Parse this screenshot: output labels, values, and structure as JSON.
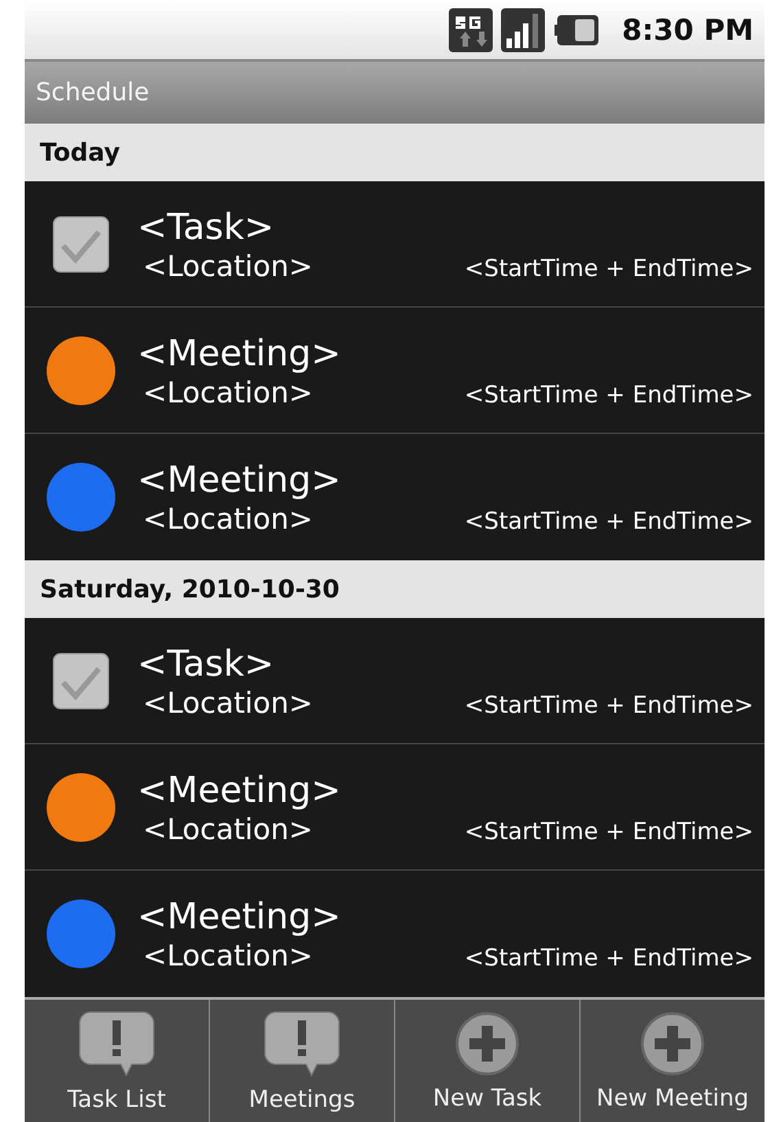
{
  "status_bar": {
    "time": "8:30 PM"
  },
  "title_bar": {
    "title": "Schedule"
  },
  "sections": [
    {
      "header": "Today",
      "items": [
        {
          "kind": "task",
          "title": "<Task>",
          "location": "<Location>",
          "time": "<StartTime + EndTime>",
          "checked": true
        },
        {
          "kind": "meeting",
          "title": "<Meeting>",
          "location": "<Location>",
          "time": "<StartTime + EndTime>",
          "color": "#f07a10"
        },
        {
          "kind": "meeting",
          "title": "<Meeting>",
          "location": "<Location>",
          "time": "<StartTime + EndTime>",
          "color": "#1e6cf0"
        }
      ]
    },
    {
      "header": "Saturday, 2010-10-30",
      "items": [
        {
          "kind": "task",
          "title": "<Task>",
          "location": "<Location>",
          "time": "<StartTime + EndTime>",
          "checked": true
        },
        {
          "kind": "meeting",
          "title": "<Meeting>",
          "location": "<Location>",
          "time": "<StartTime + EndTime>",
          "color": "#f07a10"
        },
        {
          "kind": "meeting",
          "title": "<Meeting>",
          "location": "<Location>",
          "time": "<StartTime + EndTime>",
          "color": "#1e6cf0"
        }
      ]
    }
  ],
  "bottom_bar": [
    {
      "kind": "alert",
      "label": "Task List"
    },
    {
      "kind": "alert",
      "label": "Meetings"
    },
    {
      "kind": "add",
      "label": "New Task"
    },
    {
      "kind": "add",
      "label": "New Meeting"
    }
  ]
}
